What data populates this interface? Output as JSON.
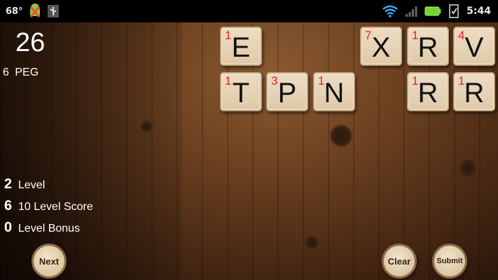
{
  "status_bar": {
    "battery_percent": "68°",
    "time": "5:44",
    "icons": [
      "android-debug-icon",
      "usb-icon",
      "wifi-icon",
      "signal-icon",
      "battery-icon",
      "sd-card-icon"
    ]
  },
  "hud": {
    "score": "26",
    "peg_count": "6",
    "peg_label": "PEG",
    "level_value": "2",
    "level_label": "Level",
    "level_score_value": "6",
    "level_score_label": "10 Level Score",
    "level_bonus_value": "0",
    "level_bonus_label": "Level Bonus"
  },
  "tiles": {
    "t1": {
      "letter": "E",
      "value": "1"
    },
    "t2": {
      "letter": "X",
      "value": "7"
    },
    "t3": {
      "letter": "R",
      "value": "1"
    },
    "t4": {
      "letter": "V",
      "value": "4"
    },
    "t5": {
      "letter": "T",
      "value": "1"
    },
    "t6": {
      "letter": "P",
      "value": "3"
    },
    "t7": {
      "letter": "N",
      "value": "1"
    },
    "t8": {
      "letter": "R",
      "value": "1"
    },
    "t9": {
      "letter": "R",
      "value": "1"
    }
  },
  "buttons": {
    "next": "Next",
    "clear": "Clear",
    "submit": "Submit"
  },
  "colors": {
    "tile_value": "#dd2222",
    "wood_dark": "#3d2210",
    "wood_light": "#8b5a32"
  }
}
